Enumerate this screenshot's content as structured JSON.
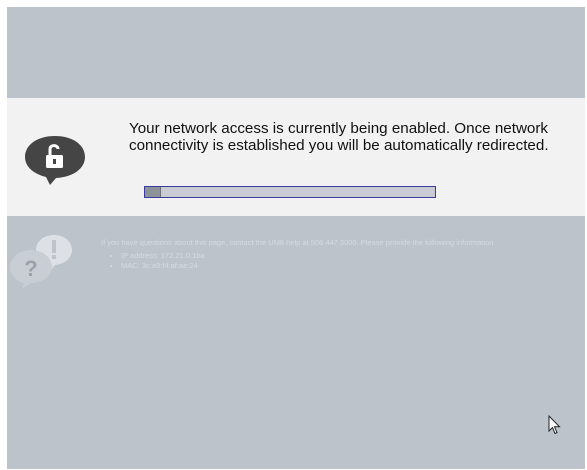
{
  "notice": {
    "icon": "unlocked-padlock-speech-bubble-icon",
    "message": "Your network access is currently being enabled. Once network connectivity is established you will be automatically redirected.",
    "progress_fraction": 0.05
  },
  "help": {
    "icon": "question-exclamation-bubbles-icon",
    "intro": "If you have questions about this page, contact the UNB help          at 506 447 3000. Please provide the following information",
    "items": [
      "IP address: 172.21.0.1ba",
      "MAC: 3c:a9:f4:af:ae:24"
    ]
  },
  "colors": {
    "background": "#bcc3cb",
    "banner": "#f2f2f2",
    "progress_border": "#3b3b9a"
  }
}
